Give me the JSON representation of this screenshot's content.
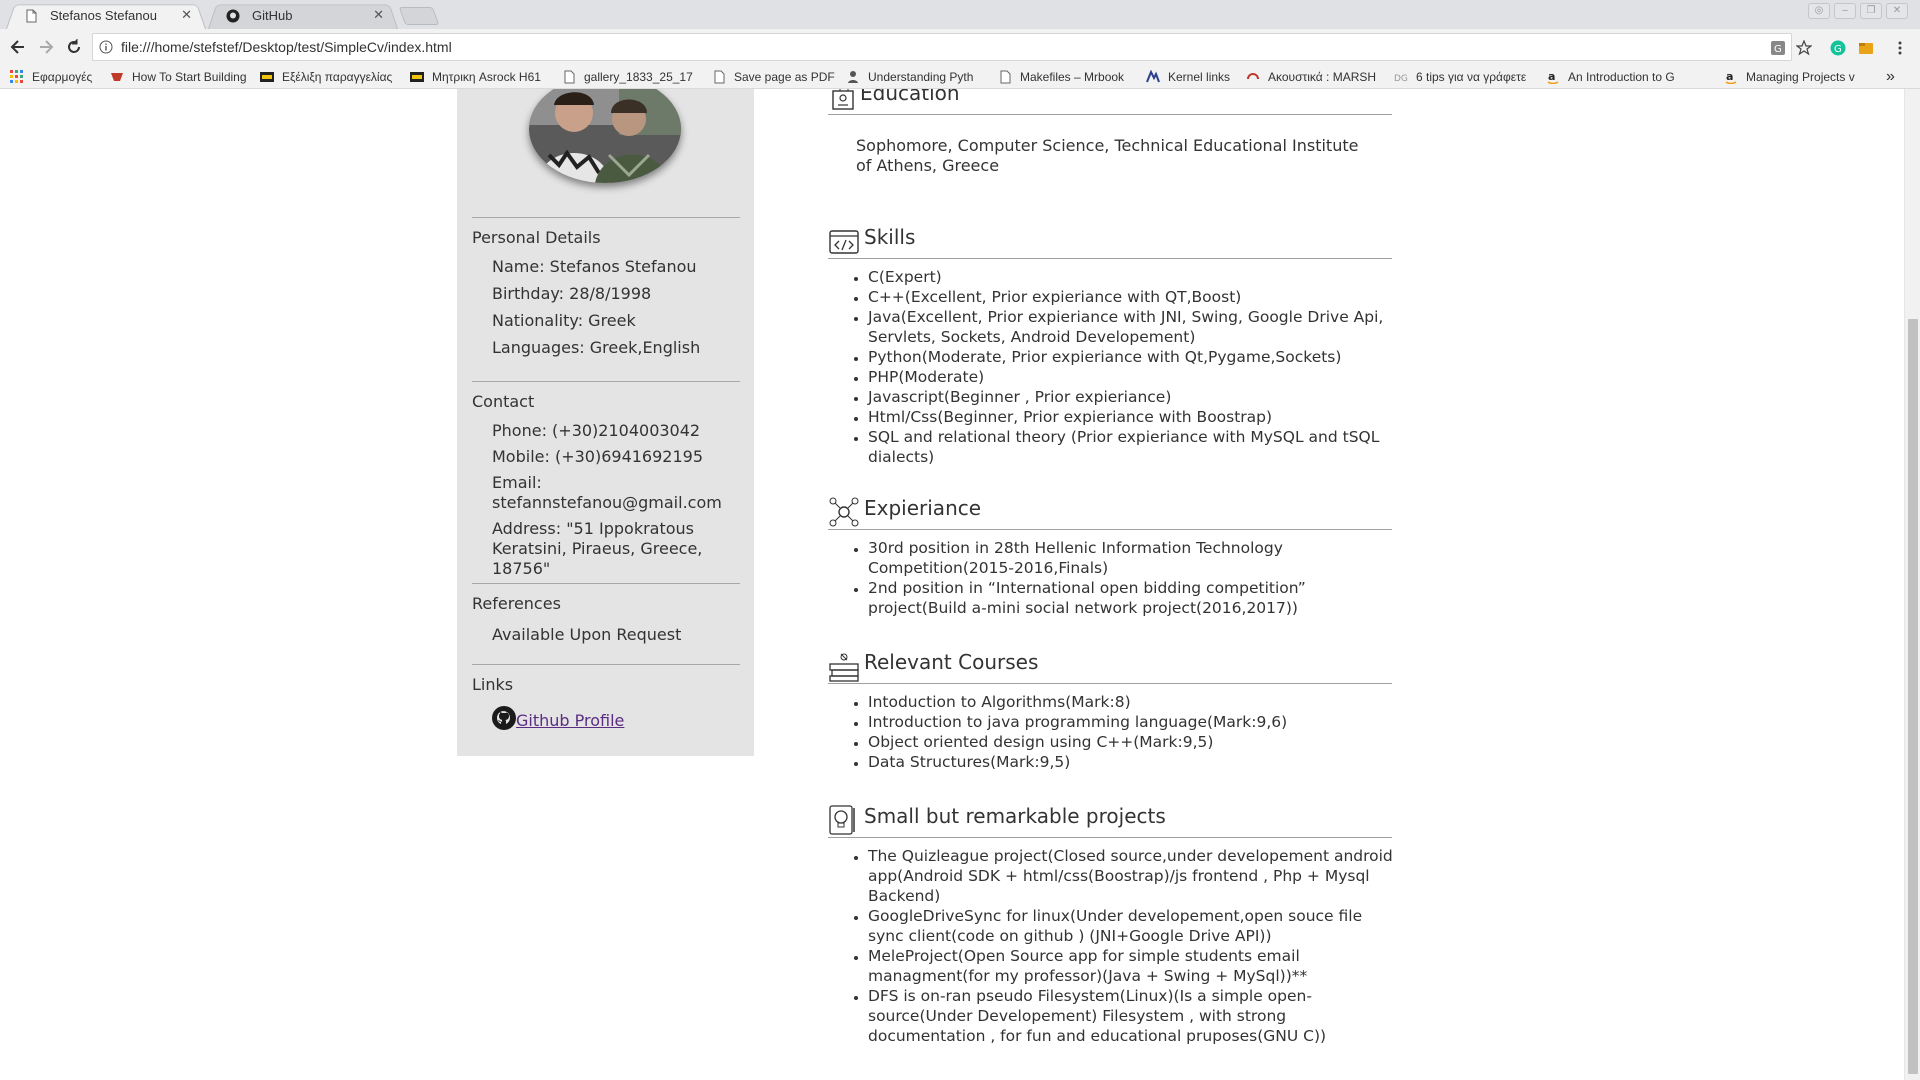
{
  "browser": {
    "tabs": [
      {
        "title": "Stefanos Stefanou",
        "active": true
      },
      {
        "title": "GitHub",
        "active": false
      }
    ],
    "url": "file:///home/stefstef/Desktop/test/SimpleCv/index.html",
    "bookmarks": [
      "Εφαρμογές",
      "How To Start Building",
      "Εξέλιξη παραγγελίας",
      "Μητρικη Asrock H61",
      "gallery_1833_25_17",
      "Save page as PDF",
      "Understanding Pyth",
      "Makefiles – Mrbook",
      "Kernel links",
      "Ακουστικά : MARSH",
      "6 tips για να γράφετε",
      "An Introduction to G",
      "Managing Projects v"
    ],
    "overflow_label": "»"
  },
  "sidebar": {
    "personal_title": "Personal Details",
    "personal": [
      "Name: Stefanos Stefanou",
      "Birthday: 28/8/1998",
      "Nationality: Greek",
      "Languages: Greek,English"
    ],
    "contact_title": "Contact",
    "phone": "Phone: (+30)2104003042",
    "mobile": "Mobile: (+30)6941692195",
    "email_label": "Email:",
    "email": "stefannstefanou@gmail.com",
    "address_1": "Address: \"51 Ippokratous",
    "address_2": "Keratsini, Piraeus, Greece, 18756\"",
    "references_title": "References",
    "references": "Available Upon Request",
    "links_title": "Links",
    "github_link": "Github Profile"
  },
  "main": {
    "education": {
      "title": "Education",
      "text": "Sophomore, Computer Science, Technical Educational Institute of Athens, Greece"
    },
    "skills": {
      "title": "Skills",
      "items": [
        "C(Expert)",
        "C++(Excellent, Prior expieriance with QT,Boost)",
        "Java(Excellent, Prior expieriance with JNI, Swing, Google Drive Api, Servlets, Sockets, Android Developement)",
        "Python(Moderate, Prior expieriance with Qt,Pygame,Sockets)",
        "PHP(Moderate)",
        "Javascript(Beginner , Prior expieriance)",
        "Html/Css(Beginner, Prior expieriance with Boostrap)",
        "SQL and relational theory (Prior expieriance with MySQL and tSQL dialects)"
      ]
    },
    "experience": {
      "title": "Expieriance",
      "items": [
        "30rd position in 28th Hellenic Information Technology Competition(2015-2016,Finals)",
        "2nd position in “International open bidding competition” project(Build a-mini social network project(2016,2017))"
      ]
    },
    "courses": {
      "title": "Relevant Courses",
      "items": [
        "Intoduction to Algorithms(Mark:8)",
        "Introduction to java programming language(Mark:9,6)",
        "Object oriented design using C++(Mark:9,5)",
        "Data Structures(Mark:9,5)"
      ]
    },
    "projects": {
      "title": "Small but remarkable projects",
      "items": [
        "The Quizleague project(Closed source,under developement android app(Android SDK + html/css(Boostrap)/js frontend , Php + Mysql Backend)",
        "GoogleDriveSync for linux(Under developement,open souce file sync client(code on github ) (JNI+Google Drive API))",
        "MeleProject(Open Source app for simple students email managment(for my professor)(Java + Swing + MySql))**",
        "DFS is on-ran pseudo Filesystem(Linux)(Is a simple open-source(Under Developement) Filesystem , with strong documentation , for fun and educational pruposes(GNU C))"
      ]
    }
  }
}
